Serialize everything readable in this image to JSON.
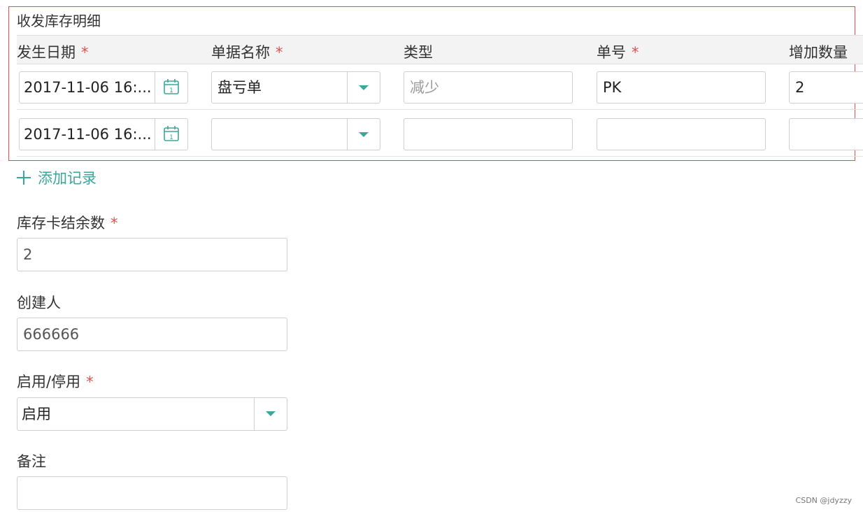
{
  "detail": {
    "title": "收发库存明细",
    "columns": [
      {
        "label": "发生日期",
        "required": "*"
      },
      {
        "label": "单据名称",
        "required": "*"
      },
      {
        "label": "类型",
        "required": ""
      },
      {
        "label": "单号",
        "required": "*"
      },
      {
        "label": "增加数量",
        "required": ""
      }
    ],
    "rows": [
      {
        "date": "2017-11-06 16:...",
        "doc_name": "盘亏单",
        "type_placeholder": "减少",
        "number": "PK",
        "qty": "2"
      },
      {
        "date": "2017-11-06 16:...",
        "doc_name": "",
        "type_placeholder": "",
        "number": "",
        "qty": ""
      }
    ],
    "add_record": "添加记录"
  },
  "form": {
    "balance": {
      "label": "库存卡结余数",
      "required": "*",
      "value": "2"
    },
    "creator": {
      "label": "创建人",
      "value": "666666"
    },
    "status": {
      "label": "启用/停用",
      "required": "*",
      "value": "启用"
    },
    "remark": {
      "label": "备注",
      "value": ""
    }
  },
  "watermark": "CSDN @jdyzzy",
  "colors": {
    "accent": "#3aa79b",
    "required": "#d9534f",
    "frame": "#d9534f"
  },
  "icons": {
    "date": "calendar-icon",
    "select": "caret-down-icon",
    "add": "plus-icon"
  }
}
